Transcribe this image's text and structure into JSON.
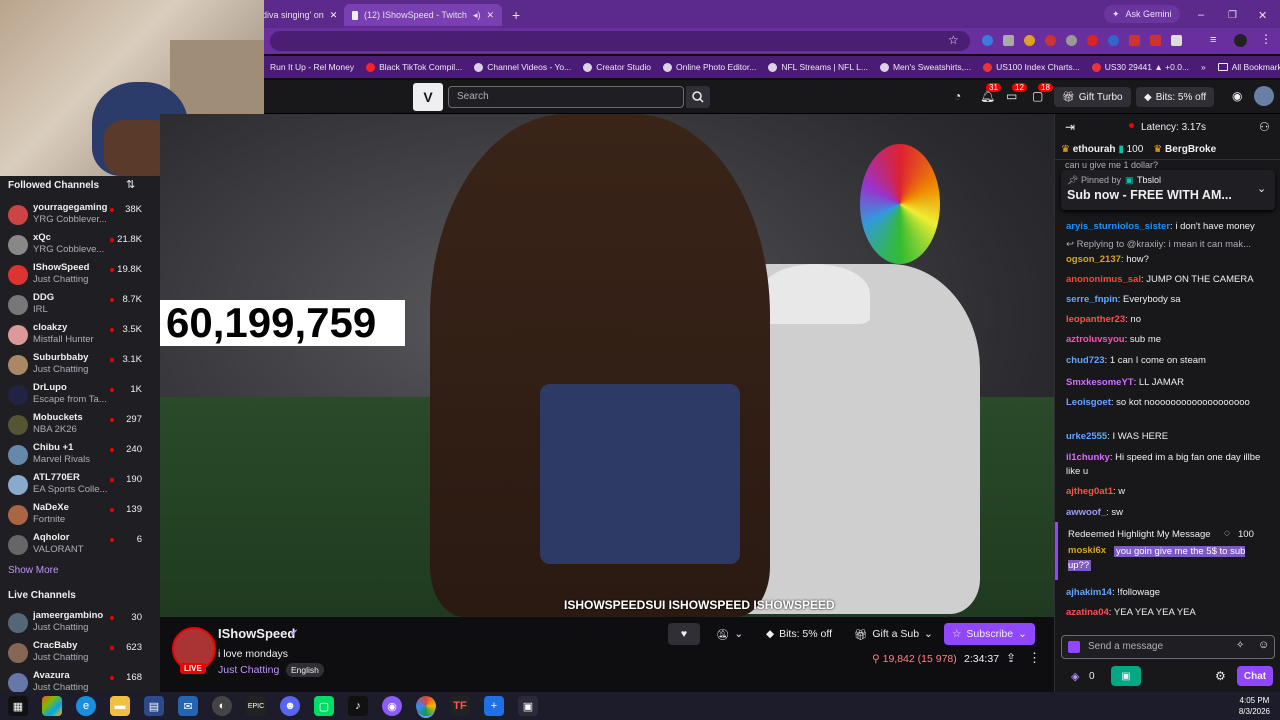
{
  "browser": {
    "tabs": [
      {
        "title": "diva singing' on",
        "active": false
      },
      {
        "title": "(12) IShowSpeed - Twitch",
        "active": true
      }
    ],
    "ask_gemini": "Ask Gemini",
    "bookmarks": [
      "Run It Up - Rel Money",
      "Black TikTok Compil...",
      "Channel Videos - Yo...",
      "Creator Studio",
      "Online Photo Editor...",
      "NFL Streams | NFL L...",
      "Men's Sweatshirts,...",
      "US100 Index Charts...",
      "US30 29441 ▲ +0.0..."
    ],
    "all_bookmarks": "All Bookmarks"
  },
  "twitch_nav": {
    "search_placeholder": "Search",
    "badges": [
      "31",
      "12",
      "18"
    ],
    "gift_turbo": "Gift Turbo",
    "bits_label": "Bits: 5% off"
  },
  "sidebar": {
    "followed_title": "Followed Channels",
    "followed": [
      {
        "name": "yourragegaming",
        "game": "YRG Cobblever...",
        "viewers": "38K",
        "color": "#c44"
      },
      {
        "name": "xQc",
        "game": "YRG Cobbleve...",
        "viewers": "21.8K",
        "color": "#888"
      },
      {
        "name": "IShowSpeed",
        "game": "Just Chatting",
        "viewers": "19.8K",
        "color": "#d33"
      },
      {
        "name": "DDG",
        "game": "IRL",
        "viewers": "8.7K",
        "color": "#777"
      },
      {
        "name": "cloakzy",
        "game": "Mistfall Hunter",
        "viewers": "3.5K",
        "color": "#d99"
      },
      {
        "name": "Suburbbaby",
        "game": "Just Chatting",
        "viewers": "3.1K",
        "color": "#a86"
      },
      {
        "name": "DrLupo",
        "game": "Escape from Ta...",
        "viewers": "1K",
        "color": "#224"
      },
      {
        "name": "Mobuckets",
        "game": "NBA 2K26",
        "viewers": "297",
        "color": "#553"
      },
      {
        "name": "Chibu +1",
        "game": "Marvel Rivals",
        "viewers": "240",
        "color": "#68a"
      },
      {
        "name": "ATL770ER",
        "game": "EA Sports Colle...",
        "viewers": "190",
        "color": "#8ac"
      },
      {
        "name": "NaDeXe",
        "game": "Fortnite",
        "viewers": "139",
        "color": "#a64"
      },
      {
        "name": "Aqholor",
        "game": "VALORANT",
        "viewers": "6",
        "color": "#666"
      }
    ],
    "show_more": "Show More",
    "live_title": "Live Channels",
    "live": [
      {
        "name": "jameergambino",
        "game": "Just Chatting",
        "viewers": "30",
        "color": "#567"
      },
      {
        "name": "CracBaby",
        "game": "Just Chatting",
        "viewers": "623",
        "color": "#865"
      },
      {
        "name": "Avazura",
        "game": "Just Chatting",
        "viewers": "168",
        "color": "#67a"
      }
    ]
  },
  "video": {
    "counter": "60,199,759",
    "watermark": "ISHOWSPEEDSUI  ISHOWSPEED  ISHOWSPEED"
  },
  "stream": {
    "channel": "IShowSpeed",
    "title": "i love mondays",
    "category": "Just Chatting",
    "tag": "English",
    "live": "LIVE",
    "bits": "Bits: 5% off",
    "gift": "Gift a Sub",
    "subscribe": "Subscribe",
    "viewers": "19,842 (15 978)",
    "uptime": "2:34:37"
  },
  "chat": {
    "latency": "Latency: 3.17s",
    "gifters": [
      {
        "name": "ethourah",
        "count": "100"
      },
      {
        "name": "BergBroke",
        "count": ""
      }
    ],
    "partial_line": "can u give me 1 dollar?",
    "pinned_by": "Pinned by",
    "pinned_user": "Tbslol",
    "pinned_msg": "Sub now - FREE WITH AM...",
    "messages": [
      {
        "user": "aryis_sturniolos_sister",
        "text": "i don't have money",
        "color": "#1e90ff"
      },
      {
        "user": "",
        "text": "Replying to @kraxiiy: i mean it can mak...",
        "color": "#adadb8"
      },
      {
        "user": "ogson_2137",
        "text": "how?",
        "color": "#daa520"
      },
      {
        "user": "anononimus_sal",
        "text": "JUMP ON THE CAMERA",
        "color": "#ff4040"
      },
      {
        "user": "serre_fnpin",
        "text": "Everybody sa",
        "color": "#5fa8ff"
      },
      {
        "user": "leopanther23",
        "text": "no",
        "color": "#ff4f4f"
      },
      {
        "user": "aztroluvsyou",
        "text": "sub me",
        "color": "#ff4fb0"
      },
      {
        "user": "chud723",
        "text": "1 can I come on steam",
        "color": "#5fa8ff"
      },
      {
        "user": "SmxkesomeYT",
        "text": "LL JAMAR",
        "color": "#d66bff"
      },
      {
        "user": "Leoisgoet",
        "text": "so kot nooooooooooooooooooo",
        "color": "#5fa8ff"
      },
      {
        "user": "urke2555",
        "text": "I WAS HERE",
        "color": "#5fa8ff"
      },
      {
        "user": "il1chunky",
        "text": "Hi speed im a big fan one day illbe like u",
        "color": "#d66bff"
      },
      {
        "user": "ajtheg0at1",
        "text": "w",
        "color": "#ff4f4f"
      },
      {
        "user": "awwoof_",
        "text": "sw",
        "color": "#9b9bff"
      }
    ],
    "highlight_title": "Redeemed Highlight My Message",
    "highlight_cost": "100",
    "highlight_user": "moski6x",
    "highlight_text": "you goin give me the 5$ to sub up??",
    "after": [
      {
        "user": "ajhakim14",
        "text": "!followage",
        "color": "#5fa8ff"
      },
      {
        "user": "azatina04",
        "text": "YEA YEA YEA YEA",
        "color": "#ff4f4f"
      }
    ],
    "input_placeholder": "Send a message",
    "points": "0",
    "chat_button": "Chat"
  },
  "taskbar": {
    "time": "4:05 PM",
    "date": "8/3/2026"
  }
}
